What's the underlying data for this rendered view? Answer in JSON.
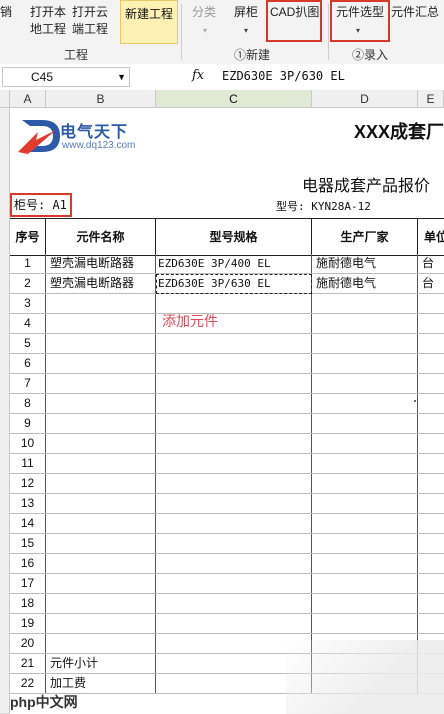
{
  "ribbon": {
    "buttons": [
      {
        "label": "销"
      },
      {
        "label": "打开本\n地工程"
      },
      {
        "label": "打开云\n端工程"
      },
      {
        "label": "新建工程"
      },
      {
        "label": "分类"
      },
      {
        "label": "屏柜"
      },
      {
        "label": "CAD扒图"
      },
      {
        "label": "元件选型"
      },
      {
        "label": "元件汇总"
      }
    ],
    "groups": {
      "project": "工程",
      "new": "①新建",
      "entry": "②录入"
    }
  },
  "formula_bar": {
    "cell_ref": "C45",
    "fx": "fx",
    "content": "EZD630E 3P/630 EL"
  },
  "columns": [
    "A",
    "B",
    "C",
    "D",
    "E"
  ],
  "doc": {
    "logo_name": "电气天下",
    "logo_url": "www.dq123.com",
    "title": "XXX成套厂",
    "subtitle": "电器成套产品报价",
    "cabinet": "柜号: A1",
    "model": "型号: KYN28A-12"
  },
  "table": {
    "headers": [
      "序号",
      "元件名称",
      "型号规格",
      "生产厂家",
      "单位"
    ],
    "rows": [
      {
        "no": "1",
        "name": "塑壳漏电断路器",
        "spec": "EZD630E 3P/400 EL",
        "maker": "施耐德电气",
        "unit": "台"
      },
      {
        "no": "2",
        "name": "塑壳漏电断路器",
        "spec": "EZD630E 3P/630 EL",
        "maker": "施耐德电气",
        "unit": "台"
      },
      {
        "no": "3"
      },
      {
        "no": "4"
      },
      {
        "no": "5"
      },
      {
        "no": "6"
      },
      {
        "no": "7"
      },
      {
        "no": "8"
      },
      {
        "no": "9"
      },
      {
        "no": "10"
      },
      {
        "no": "11"
      },
      {
        "no": "12"
      },
      {
        "no": "13"
      },
      {
        "no": "14"
      },
      {
        "no": "15"
      },
      {
        "no": "16"
      },
      {
        "no": "17"
      },
      {
        "no": "18"
      },
      {
        "no": "19"
      },
      {
        "no": "20"
      },
      {
        "no": "21",
        "name": "元件小计"
      },
      {
        "no": "22",
        "name": "加工费"
      }
    ]
  },
  "hint": "添加元件",
  "watermark": "php中文网",
  "colors": {
    "highlight": "#d9382c",
    "new_button": "#fdf2b3",
    "hint": "#d84d5a",
    "logo": "#2c5aa8"
  }
}
